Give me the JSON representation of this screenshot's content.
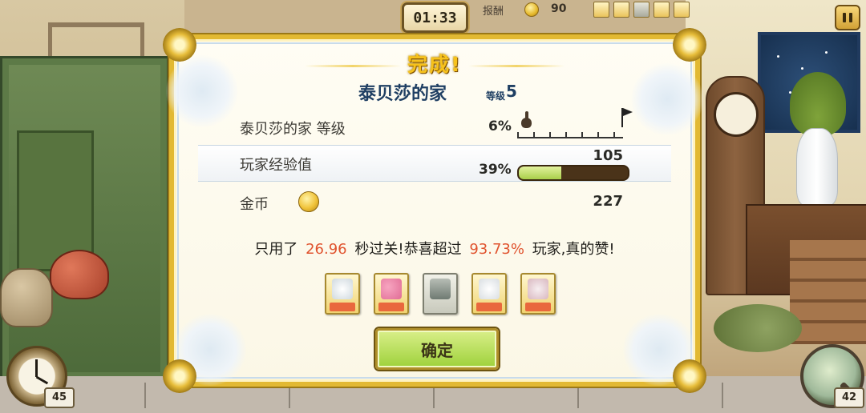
{
  "hud": {
    "timer": "01:33",
    "reward_label": "报酬",
    "reward_value": "90",
    "reward_items": [
      "coupon-item",
      "snowman-item",
      "book-item",
      "candy-item",
      "bell-item"
    ],
    "left_counter": "45",
    "right_counter": "42"
  },
  "dialog": {
    "title": "完成!",
    "location": "泰贝莎的家",
    "level_word": "等级",
    "level_value": "5",
    "rows": [
      {
        "label": "泰贝莎的家 等级",
        "percent": "6%",
        "progress": 0.06
      },
      {
        "label": "玩家经验值",
        "percent": "39%",
        "value": "105",
        "progress": 0.39
      },
      {
        "label": "金币",
        "value": "227"
      }
    ],
    "summary": {
      "prefix": "只用了",
      "time": "26.96",
      "middle": "秒过关!恭喜超过",
      "percent": "93.73%",
      "suffix": "玩家,真的赞!"
    },
    "rewards": [
      "snow-tree-coupon",
      "balloons-coupon",
      "books-item",
      "snowman-coupon",
      "cake-coupon"
    ],
    "confirm_label": "确定"
  },
  "colors": {
    "frame_gold": "#e2b933",
    "title_navy": "#1f3f63",
    "highlight": "#e0532e",
    "button_green": "#9ed13b",
    "xp_fill": "#a9cf4a"
  }
}
